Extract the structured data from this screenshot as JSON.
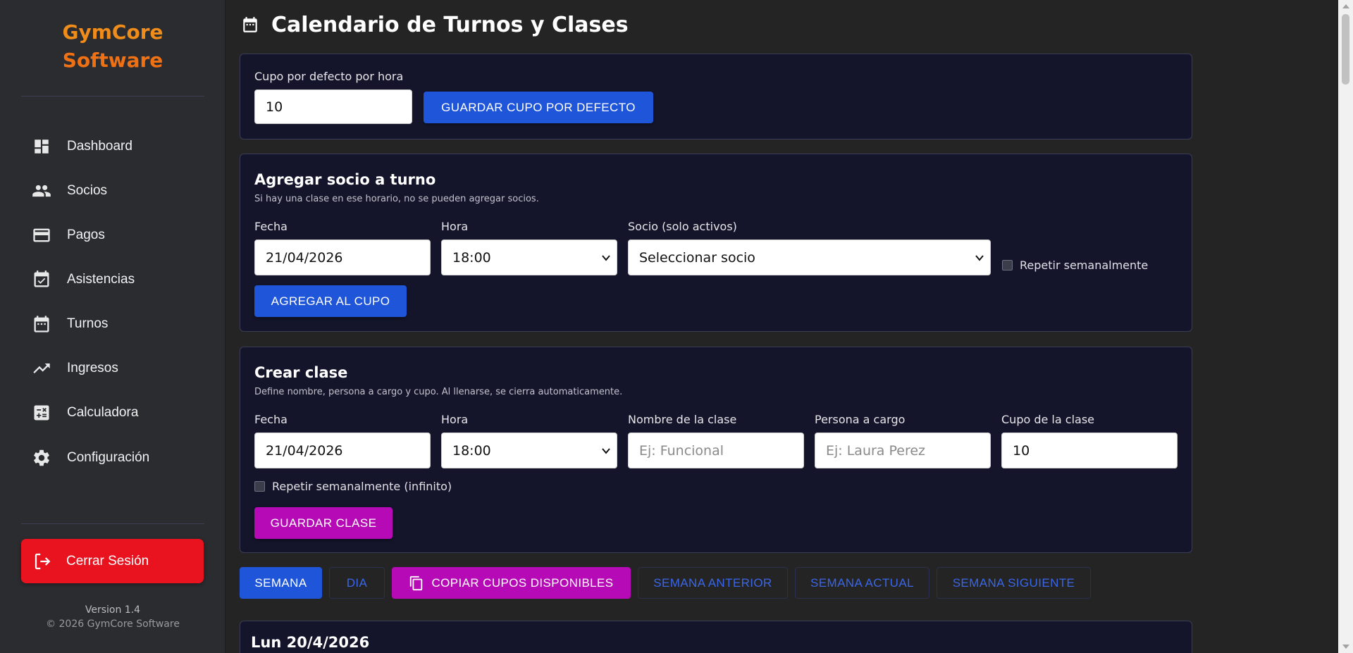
{
  "sidebar": {
    "brand_line1": "GymCore",
    "brand_line2": "Software",
    "items": [
      {
        "label": "Dashboard",
        "icon": "dashboard-icon"
      },
      {
        "label": "Socios",
        "icon": "people-icon"
      },
      {
        "label": "Pagos",
        "icon": "credit-card-icon"
      },
      {
        "label": "Asistencias",
        "icon": "calendar-check-icon"
      },
      {
        "label": "Turnos",
        "icon": "calendar-icon"
      },
      {
        "label": "Ingresos",
        "icon": "trending-up-icon"
      },
      {
        "label": "Calculadora",
        "icon": "calculator-icon"
      },
      {
        "label": "Configuración",
        "icon": "gear-icon"
      }
    ],
    "logout_label": "Cerrar Sesión",
    "version": "Version 1.4",
    "copyright": "© 2026 GymCore Software"
  },
  "page": {
    "title": "Calendario de Turnos y Clases"
  },
  "default_capacity": {
    "label": "Cupo por defecto por hora",
    "value": "10",
    "save_button": "GUARDAR CUPO POR DEFECTO"
  },
  "add_member": {
    "title": "Agregar socio a turno",
    "subtitle": "Si hay una clase en ese horario, no se pueden agregar socios.",
    "date_label": "Fecha",
    "date_value": "21/04/2026",
    "hour_label": "Hora",
    "hour_value": "18:00",
    "member_label": "Socio (solo activos)",
    "member_value": "Seleccionar socio",
    "repeat_label": "Repetir semanalmente",
    "add_button": "AGREGAR AL CUPO"
  },
  "create_class": {
    "title": "Crear clase",
    "subtitle": "Define nombre, persona a cargo y cupo. Al llenarse, se cierra automaticamente.",
    "date_label": "Fecha",
    "date_value": "21/04/2026",
    "hour_label": "Hora",
    "hour_value": "18:00",
    "name_label": "Nombre de la clase",
    "name_placeholder": "Ej: Funcional",
    "person_label": "Persona a cargo",
    "person_placeholder": "Ej: Laura Perez",
    "capacity_label": "Cupo de la clase",
    "capacity_value": "10",
    "repeat_label": "Repetir semanalmente (infinito)",
    "save_button": "GUARDAR CLASE"
  },
  "toolbar": {
    "week": "SEMANA",
    "day": "DIA",
    "copy": "COPIAR CUPOS DISPONIBLES",
    "prev_week": "SEMANA ANTERIOR",
    "current_week": "SEMANA ACTUAL",
    "next_week": "SEMANA SIGUIENTE"
  },
  "calendar": {
    "first_day": "Lun 20/4/2026"
  },
  "colors": {
    "accent_blue": "#1f55d8",
    "accent_magenta": "#b50ab5",
    "danger_red": "#e8131f",
    "brand_orange": "#f08c1a"
  }
}
